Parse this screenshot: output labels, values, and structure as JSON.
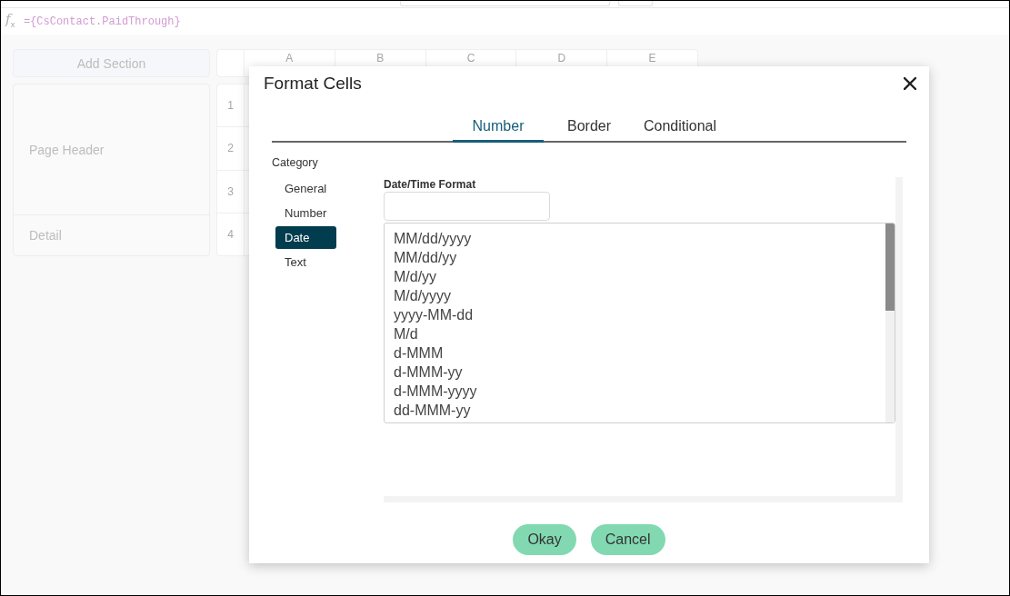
{
  "formula_bar": {
    "icon": "*f*$_{x}$",
    "formula": "={CsContact.PaidThrough}"
  },
  "sections": {
    "add_button": "Add Section",
    "items": [
      "Page Header",
      "Detail"
    ]
  },
  "grid": {
    "columns": [
      "A",
      "B",
      "C",
      "D",
      "E"
    ],
    "rows": [
      "1",
      "2",
      "3",
      "4"
    ]
  },
  "dialog": {
    "title": "Format Cells",
    "tabs": [
      {
        "label": "Number",
        "selected": true
      },
      {
        "label": "Border",
        "selected": false
      },
      {
        "label": "Conditional",
        "selected": false
      }
    ],
    "category": {
      "label": "Category",
      "items": [
        {
          "label": "General",
          "selected": false
        },
        {
          "label": "Number",
          "selected": false
        },
        {
          "label": "Date",
          "selected": true
        },
        {
          "label": "Text",
          "selected": false
        }
      ]
    },
    "format": {
      "label": "Date/Time Format",
      "options": [
        {
          "label": "MM/dd/yyyy",
          "selected": false
        },
        {
          "label": "MM/dd/yy",
          "selected": false
        },
        {
          "label": "M/d/yy",
          "selected": false
        },
        {
          "label": "M/d/yyyy",
          "selected": false
        },
        {
          "label": "yyyy-MM-dd",
          "selected": false
        },
        {
          "label": "M/d",
          "selected": false
        },
        {
          "label": "d-MMM",
          "selected": false
        },
        {
          "label": "d-MMM-yy",
          "selected": false
        },
        {
          "label": "d-MMM-yyyy",
          "selected": false
        },
        {
          "label": "dd-MMM-yy",
          "selected": false
        }
      ]
    },
    "buttons": [
      "Okay",
      "Cancel"
    ]
  }
}
